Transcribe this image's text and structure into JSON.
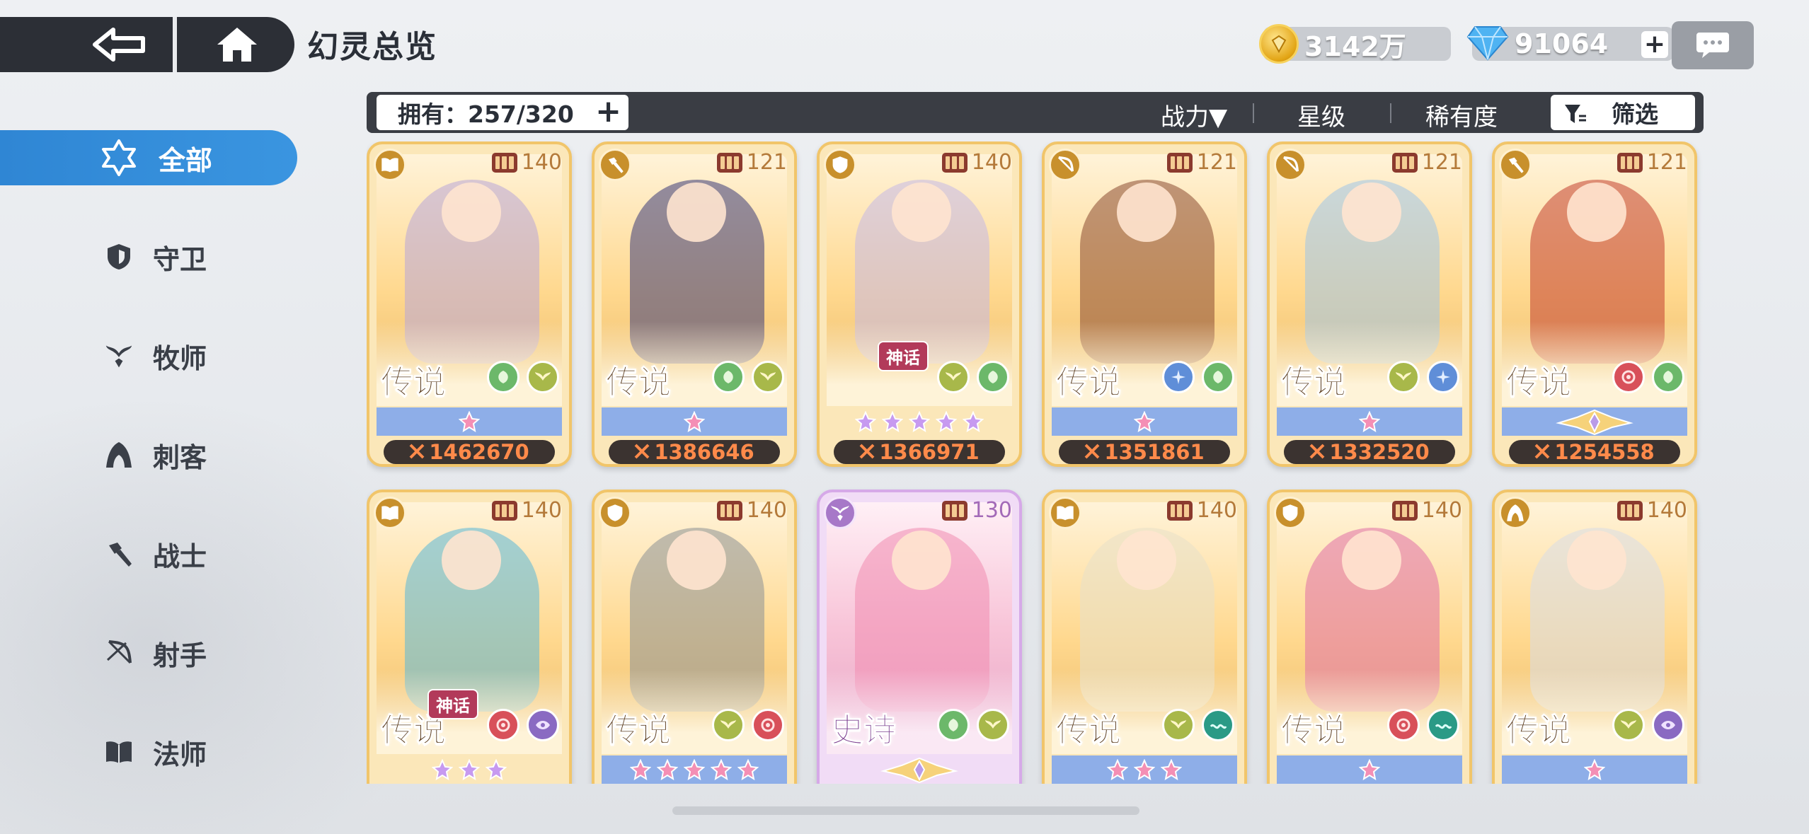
{
  "header": {
    "title": "幻灵总览",
    "gold_amount": "3142万",
    "gem_amount": "91064",
    "gem_plus": "+"
  },
  "sidebar": {
    "items": [
      {
        "label": "全部",
        "icon": "star-of-david-icon",
        "active": true
      },
      {
        "label": "守卫",
        "icon": "shield-icon"
      },
      {
        "label": "牧师",
        "icon": "wings-icon"
      },
      {
        "label": "刺客",
        "icon": "hood-icon"
      },
      {
        "label": "战士",
        "icon": "hammer-icon"
      },
      {
        "label": "射手",
        "icon": "bow-icon"
      },
      {
        "label": "法师",
        "icon": "book-icon"
      }
    ]
  },
  "filter": {
    "owned_label": "拥有：257/320",
    "owned_plus": "+",
    "sort_power": "战力▼",
    "sort_star": "星级",
    "sort_rarity": "稀有度",
    "filter_label": "筛选"
  },
  "colors": {
    "accent_blue": "#2f86d4",
    "card_gold": "#f1c56a",
    "card_epic": "#d6a9e8",
    "power_orange": "#ff8a4a",
    "star_pink": "#f48fb5"
  },
  "cards": [
    {
      "role_icon": "book-icon",
      "level": "140",
      "rarity": "传说",
      "mythic": "",
      "elements": [
        "leaf",
        "wing"
      ],
      "stars": 1,
      "star_style": "pink",
      "power": "1462670",
      "tint": "#b8a6d9"
    },
    {
      "role_icon": "hammer-icon",
      "level": "121",
      "rarity": "传说",
      "mythic": "",
      "elements": [
        "leaf",
        "wing"
      ],
      "stars": 1,
      "star_style": "pink",
      "power": "1386646",
      "tint": "#3a3a78"
    },
    {
      "role_icon": "shield-icon",
      "level": "140",
      "rarity": "",
      "mythic": "神话",
      "elements": [
        "wing",
        "leaf"
      ],
      "stars": 5,
      "star_style": "purple",
      "power": "1366971",
      "tint": "#c4b8e6"
    },
    {
      "role_icon": "bow-icon",
      "level": "121",
      "rarity": "传说",
      "mythic": "",
      "elements": [
        "spark",
        "leaf"
      ],
      "stars": 1,
      "star_style": "pink",
      "power": "1351861",
      "tint": "#8a4a32"
    },
    {
      "role_icon": "bow-icon",
      "level": "121",
      "rarity": "传说",
      "mythic": "",
      "elements": [
        "wing",
        "spark"
      ],
      "stars": 1,
      "star_style": "pink",
      "power": "1332520",
      "tint": "#9ec4e8"
    },
    {
      "role_icon": "hammer-icon",
      "level": "121",
      "rarity": "传说",
      "mythic": "",
      "elements": [
        "swirl",
        "leaf"
      ],
      "stars": 0,
      "star_style": "crown",
      "power": "1254558",
      "tint": "#c24030"
    },
    {
      "role_icon": "book-icon",
      "level": "140",
      "rarity": "传说",
      "mythic": "神话",
      "elements": [
        "swirl",
        "eye"
      ],
      "stars": 3,
      "star_style": "purple",
      "power": "",
      "tint": "#5ab8d8"
    },
    {
      "role_icon": "shield-icon",
      "level": "140",
      "rarity": "传说",
      "mythic": "",
      "elements": [
        "wing",
        "swirl"
      ],
      "stars": 5,
      "star_style": "pink",
      "power": "",
      "tint": "#8c9296"
    },
    {
      "role_icon": "wings-icon",
      "level": "130",
      "rarity": "史诗",
      "mythic": "",
      "elements": [
        "leaf",
        "wing"
      ],
      "stars": 0,
      "star_style": "crown",
      "power": "",
      "tint": "#f08cb0",
      "epic": true
    },
    {
      "role_icon": "book-icon",
      "level": "140",
      "rarity": "传说",
      "mythic": "",
      "elements": [
        "wing",
        "wave"
      ],
      "stars": 3,
      "star_style": "pink",
      "power": "",
      "tint": "#e8e0c8"
    },
    {
      "role_icon": "shield-icon",
      "level": "140",
      "rarity": "传说",
      "mythic": "",
      "elements": [
        "swirl",
        "wave"
      ],
      "stars": 1,
      "star_style": "pink",
      "power": "",
      "tint": "#e070a8"
    },
    {
      "role_icon": "hood-icon",
      "level": "140",
      "rarity": "传说",
      "mythic": "",
      "elements": [
        "wing",
        "eye"
      ],
      "stars": 1,
      "star_style": "pink",
      "power": "",
      "tint": "#d8dce6"
    }
  ]
}
